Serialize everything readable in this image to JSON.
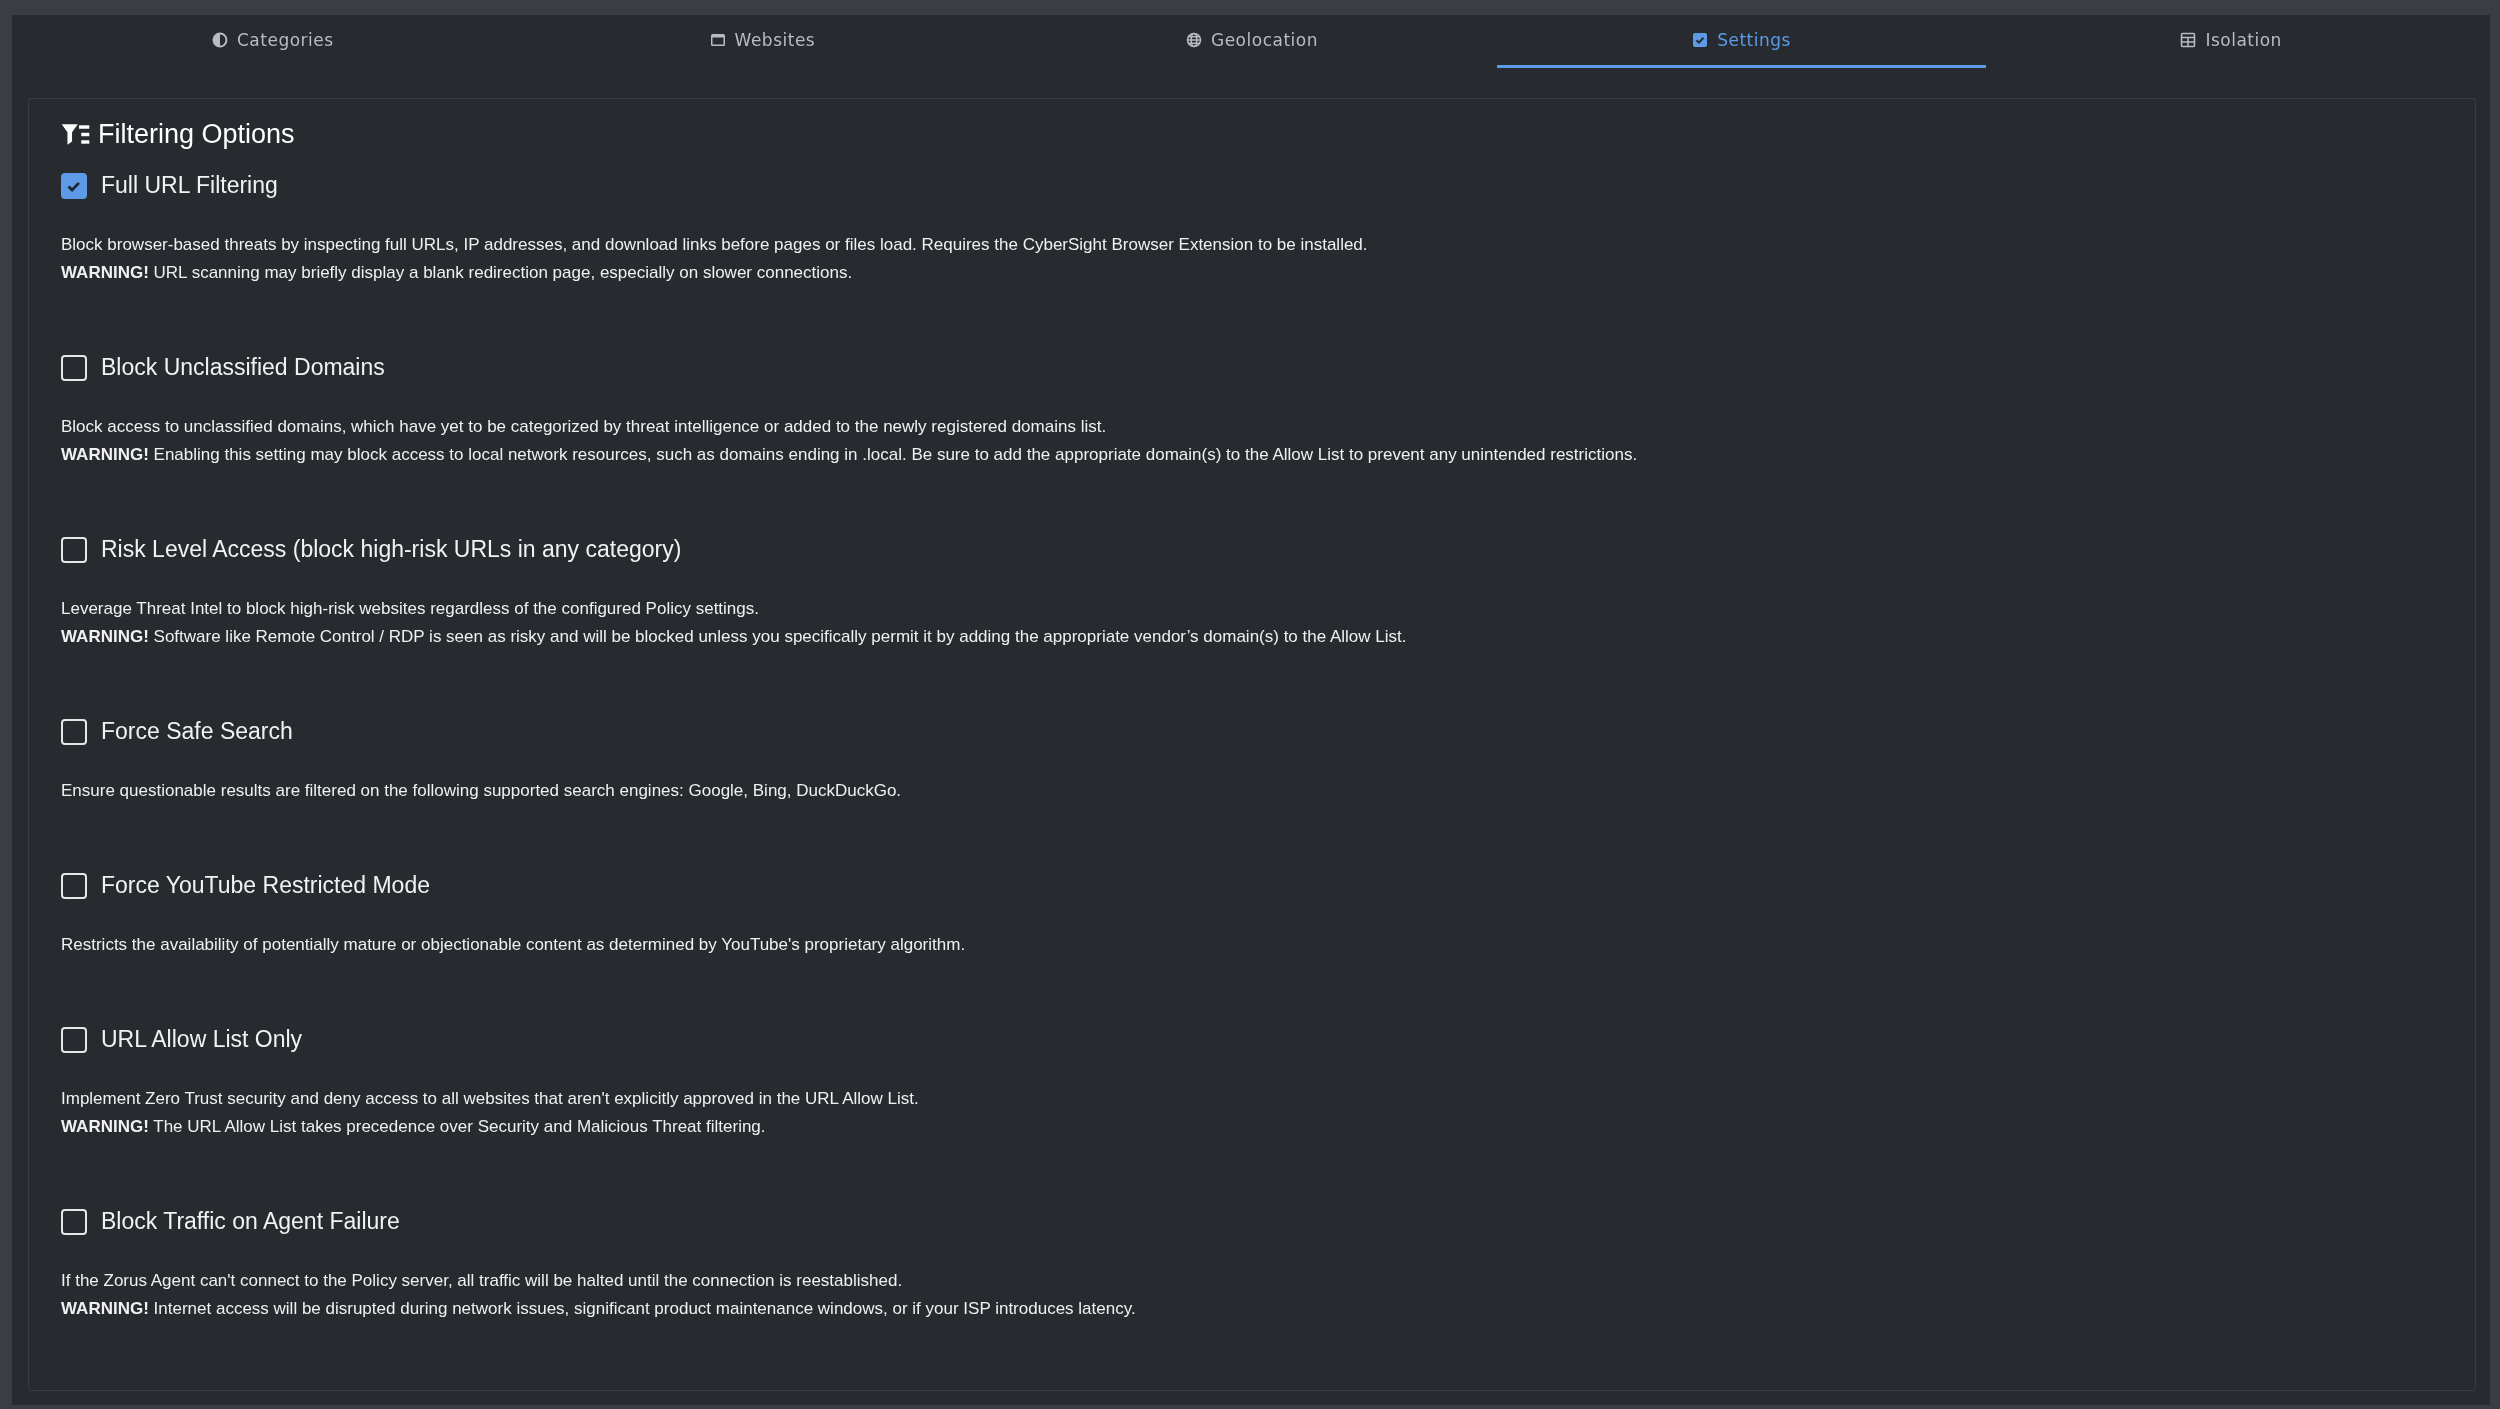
{
  "tabs": [
    {
      "label": "Categories",
      "selected": false
    },
    {
      "label": "Websites",
      "selected": false
    },
    {
      "label": "Geolocation",
      "selected": false
    },
    {
      "label": "Settings",
      "selected": true
    },
    {
      "label": "Isolation",
      "selected": false
    }
  ],
  "panel": {
    "title": "Filtering Options",
    "options": [
      {
        "label": "Full URL Filtering",
        "checked": true,
        "description": [
          "Block browser-based threats by inspecting full URLs, IP addresses, and download links before pages or files load. Requires the CyberSight Browser Extension to be installed.",
          "**WARNING!** URL scanning may briefly display a blank redirection page, especially on slower connections."
        ]
      },
      {
        "label": "Block Unclassified Domains",
        "checked": false,
        "description": [
          "Block access to unclassified domains, which have yet to be categorized by threat intelligence or added to the newly registered domains list.",
          "**WARNING!** Enabling this setting may block access to local network resources, such as domains ending in .local. Be sure to add the appropriate domain(s) to the Allow List to prevent any unintended restrictions."
        ]
      },
      {
        "label": "Risk Level Access (block high-risk URLs in any category)",
        "checked": false,
        "description": [
          "Leverage Threat Intel to block high-risk websites regardless of the configured Policy settings.",
          "**WARNING!** Software like Remote Control / RDP is seen as risky and will be blocked unless you specifically permit it by adding the appropriate vendor’s domain(s) to the Allow List."
        ]
      },
      {
        "label": "Force Safe Search",
        "checked": false,
        "description": [
          "Ensure questionable results are filtered on the following supported search engines: Google, Bing, DuckDuckGo."
        ]
      },
      {
        "label": "Force YouTube Restricted Mode",
        "checked": false,
        "description": [
          "Restricts the availability of potentially mature or objectionable content as determined by YouTube's proprietary algorithm."
        ]
      },
      {
        "label": "URL Allow List Only",
        "checked": false,
        "description": [
          "Implement Zero Trust security and deny access to all websites that aren't explicitly approved in the URL Allow List.",
          "**WARNING!** The URL Allow List takes precedence over Security and Malicious Threat filtering."
        ]
      },
      {
        "label": "Block Traffic on Agent Failure",
        "checked": false,
        "description": [
          "If the Zorus Agent can't connect to the Policy server, all traffic will be halted until the connection is reestablished.",
          "**WARNING!** Internet access will be disrupted during network issues, significant product maintenance windows, or if your ISP introduces latency."
        ]
      }
    ]
  }
}
